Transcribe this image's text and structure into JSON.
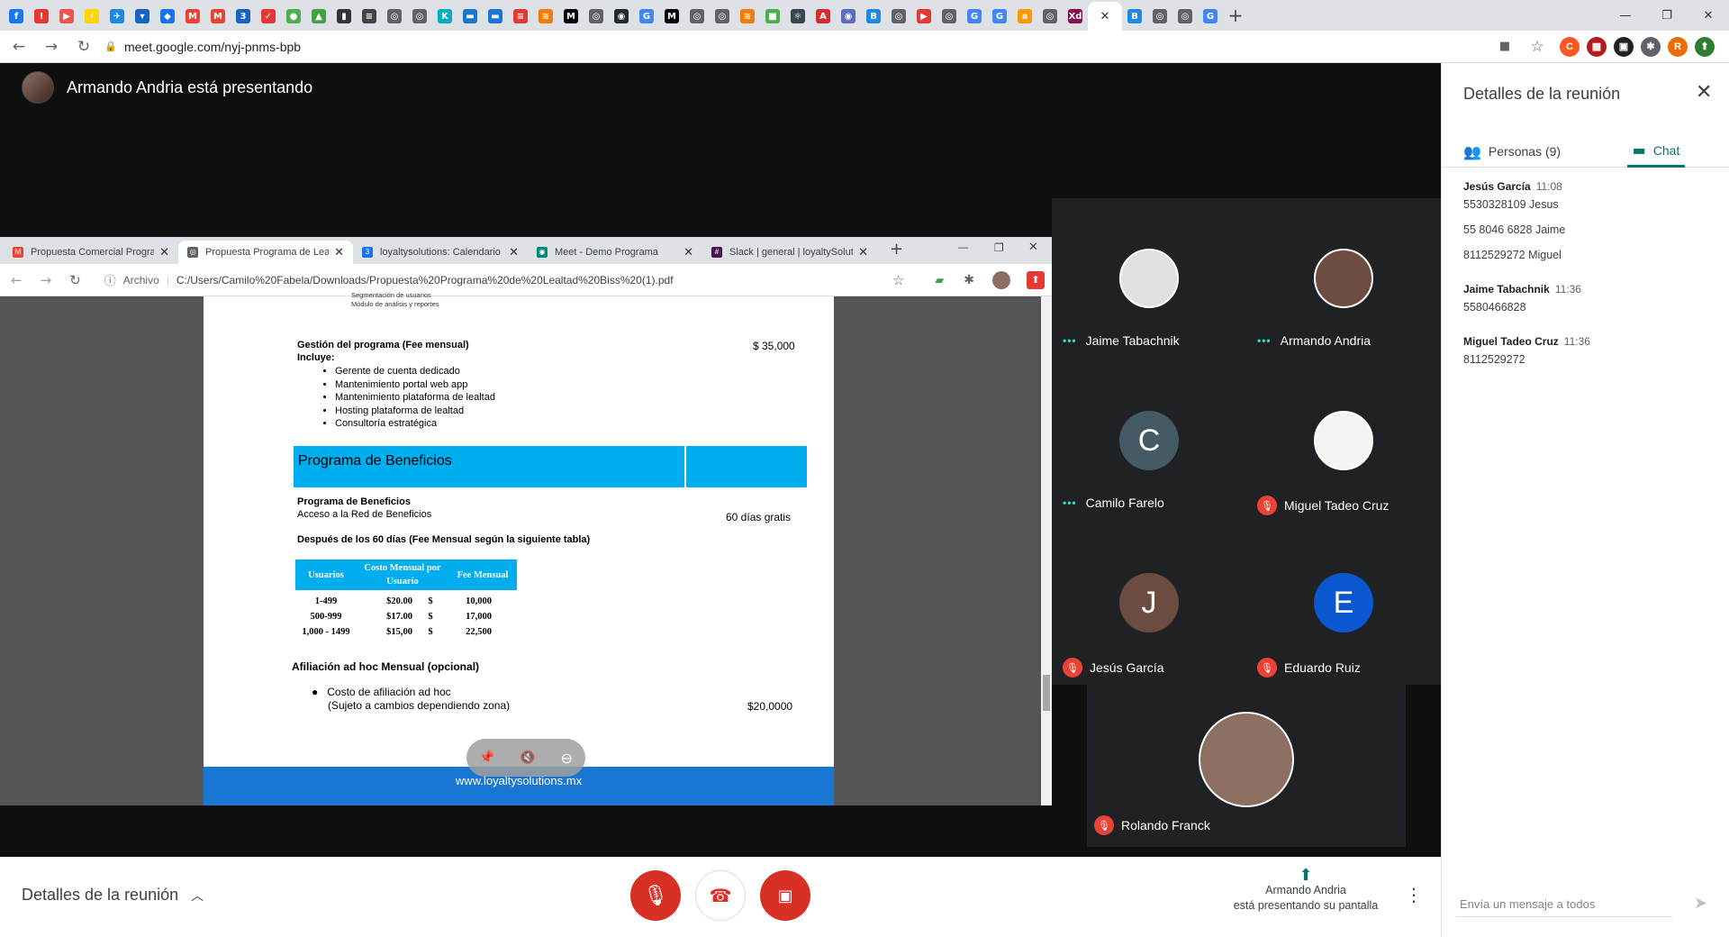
{
  "browser": {
    "url": "meet.google.com/nyj-pnms-bpb",
    "tab_favicons": [
      {
        "c": "#1877f2",
        "g": "f"
      },
      {
        "c": "#e53935",
        "g": "!"
      },
      {
        "c": "#ef5350",
        "g": "▶"
      },
      {
        "c": "#ffd600",
        "g": "⚡"
      },
      {
        "c": "#1e88e5",
        "g": "✈"
      },
      {
        "c": "#1565c0",
        "g": "▾"
      },
      {
        "c": "#1a73e8",
        "g": "◆"
      },
      {
        "c": "#ea4335",
        "g": "M"
      },
      {
        "c": "#ea4335",
        "g": "M"
      },
      {
        "c": "#1565c0",
        "g": "3"
      },
      {
        "c": "#e53935",
        "g": "✓"
      },
      {
        "c": "#4caf50",
        "g": "●"
      },
      {
        "c": "#43a047",
        "g": "▲"
      },
      {
        "c": "#333333",
        "g": "▮"
      },
      {
        "c": "#424242",
        "g": "≡"
      },
      {
        "c": "#5f6368",
        "g": "◎"
      },
      {
        "c": "#5f6368",
        "g": "◎"
      },
      {
        "c": "#00acc1",
        "g": "K"
      },
      {
        "c": "#1976d2",
        "g": "▬"
      },
      {
        "c": "#1976d2",
        "g": "▬"
      },
      {
        "c": "#e53935",
        "g": "≡"
      },
      {
        "c": "#f57c00",
        "g": "≋"
      },
      {
        "c": "#000000",
        "g": "M"
      },
      {
        "c": "#5f6368",
        "g": "◎"
      },
      {
        "c": "#24292e",
        "g": "◉"
      },
      {
        "c": "#4285f4",
        "g": "G"
      },
      {
        "c": "#000000",
        "g": "M"
      },
      {
        "c": "#5f6368",
        "g": "◎"
      },
      {
        "c": "#5f6368",
        "g": "◎"
      },
      {
        "c": "#f57c00",
        "g": "≋"
      },
      {
        "c": "#4caf50",
        "g": "■"
      },
      {
        "c": "#37474f",
        "g": "⚛"
      },
      {
        "c": "#d32f2f",
        "g": "A"
      },
      {
        "c": "#5c6bc0",
        "g": "◉"
      },
      {
        "c": "#1e88e5",
        "g": "B"
      },
      {
        "c": "#5f6368",
        "g": "◎"
      },
      {
        "c": "#e53935",
        "g": "▶"
      },
      {
        "c": "#5f6368",
        "g": "◎"
      },
      {
        "c": "#4285f4",
        "g": "G"
      },
      {
        "c": "#4285f4",
        "g": "G"
      },
      {
        "c": "#ff9800",
        "g": "a"
      },
      {
        "c": "#5f6368",
        "g": "◎"
      },
      {
        "c": "#880e4f",
        "g": "Xd"
      }
    ],
    "tab_favicons_after": [
      {
        "c": "#1e88e5",
        "g": "B"
      },
      {
        "c": "#5f6368",
        "g": "◎"
      },
      {
        "c": "#5f6368",
        "g": "◎"
      },
      {
        "c": "#4285f4",
        "g": "G"
      }
    ],
    "window_controls": {
      "minimize": "—",
      "restore": "❐",
      "close": "✕"
    },
    "extensions": [
      {
        "c": "#ff5722",
        "g": "C"
      },
      {
        "c": "#b71c1c",
        "g": "▦"
      },
      {
        "c": "#212121",
        "g": "▣"
      },
      {
        "c": "#5f6368",
        "g": "✱"
      },
      {
        "c": "#ef6c00",
        "g": "R"
      },
      {
        "c": "#2e7d32",
        "g": "⬆"
      }
    ]
  },
  "meet": {
    "presenter_banner": "Armando Andria está presentando",
    "shared_browser": {
      "tabs": [
        {
          "title": "Propuesta Comercial Program",
          "icon_color": "#ea4335",
          "icon": "M"
        },
        {
          "title": "Propuesta Programa de Lealtad",
          "icon_color": "#5f6368",
          "icon": "◎"
        },
        {
          "title": "loyaltysolutions: Calendario",
          "icon_color": "#1a73e8",
          "icon": "3"
        },
        {
          "title": "Meet - Demo Programa",
          "icon_color": "#00897b",
          "icon": "◉"
        },
        {
          "title": "Slack | general | loyaltySolutions",
          "icon_color": "#4a154b",
          "icon": "#"
        }
      ],
      "address_prefix": "Archivo",
      "address": "C:/Users/Camilo%20Fabela/Downloads/Propuesta%20Programa%20de%20Lealtad%20Biss%20(1).pdf",
      "window_controls": {
        "minimize": "—",
        "restore": "❐",
        "close": "✕"
      }
    },
    "pdf": {
      "top_bullets": [
        "Segmentación de usuarios",
        "Módulo de análisis y reportes"
      ],
      "gestion_title": "Gestión del programa (Fee mensual)",
      "gestion_price": "$ 35,000",
      "incluye": "Incluye:",
      "gestion_items": [
        "Gerente de cuenta dedicado",
        "Mantenimiento portal web app",
        "Mantenimiento plataforma de lealtad",
        "Hosting plataforma de lealtad",
        "Consultoría estratégica"
      ],
      "beneficios_header": "Programa de Beneficios",
      "beneficios_title": "Programa de Beneficios",
      "beneficios_sub": "Acceso a la Red de Beneficios",
      "beneficios_price": "60 días gratis",
      "despues": "Después de los 60 días (Fee Mensual según la siguiente tabla)",
      "table_headers": [
        "Usuarios",
        "Costo Mensual por Usuario",
        "Fee Mensual"
      ],
      "table_rows": [
        [
          "1-499",
          "$20.00",
          "$",
          "10,000"
        ],
        [
          "500-999",
          "$17.00",
          "$",
          "17,000"
        ],
        [
          "1,000 - 1499",
          "$15,00",
          "$",
          "22,500"
        ]
      ],
      "afiliacion_title": "Afiliación ad hoc Mensual (opcional)",
      "afiliacion_item": "Costo de afiliación ad hoc",
      "afiliacion_note": "(Sujeto a cambios dependiendo zona)",
      "afiliacion_price": "$20,0000",
      "footer": "www.loyaltysolutions.mx"
    },
    "pdf_toolbar": {
      "pin": "📌",
      "mute": "🔇",
      "minus": "⊖"
    },
    "participants": [
      {
        "name": "Jaime Tabachnik",
        "status": "talking",
        "initial": "",
        "color": "#e0e0e0"
      },
      {
        "name": "Armando Andria",
        "status": "talking",
        "initial": "",
        "color": "#6d4c41"
      },
      {
        "name": "Camilo Farelo",
        "status": "talking",
        "initial": "C",
        "color": "#455a64"
      },
      {
        "name": "Miguel Tadeo Cruz",
        "status": "muted",
        "initial": "",
        "color": "#f5f5f5"
      },
      {
        "name": "Jesús García",
        "status": "muted",
        "initial": "J",
        "color": "#6d4c41"
      },
      {
        "name": "Eduardo Ruiz",
        "status": "muted",
        "initial": "E",
        "color": "#0b57d0"
      },
      {
        "name": "Rolando Franck",
        "status": "muted",
        "initial": "",
        "color": "#8d6e63"
      }
    ],
    "bottom": {
      "details_label": "Detalles de la reunión",
      "presenting_line1": "Armando Andria",
      "presenting_line2": "está presentando su pantalla",
      "colors": {
        "mic": "#d93025",
        "end": "#ffffff",
        "cam": "#d93025"
      }
    },
    "panel": {
      "title": "Detalles de la reunión",
      "tab_people": "Personas (9)",
      "tab_chat": "Chat",
      "messages": [
        {
          "who": "Jesús García",
          "time": "11:08",
          "lines": [
            "5530328109 Jesus",
            "55 8046 6828 Jaime",
            "8112529272 Miguel"
          ]
        },
        {
          "who": "Jaime Tabachnik",
          "time": "11:36",
          "lines": [
            "5580466828"
          ]
        },
        {
          "who": "Miguel Tadeo Cruz",
          "time": "11:36",
          "lines": [
            "8112529272"
          ]
        }
      ],
      "compose_placeholder": "Envía un mensaje a todos"
    }
  }
}
